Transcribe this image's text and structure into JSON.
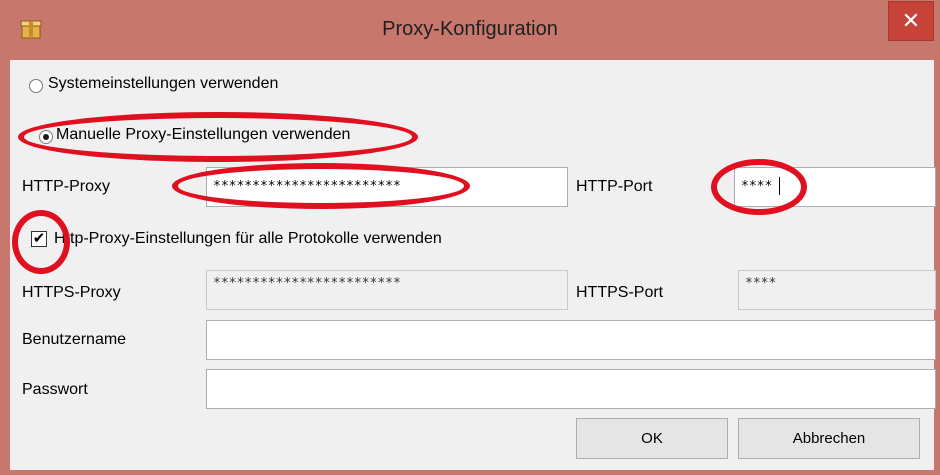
{
  "window": {
    "title": "Proxy-Konfiguration",
    "close_label": "✕",
    "app_icon": "box-icon"
  },
  "options": {
    "system_label": "Systemeinstellungen verwenden",
    "manual_label": "Manuelle Proxy-Einstellungen verwenden",
    "selected": "manual"
  },
  "http": {
    "proxy_label": "HTTP-Proxy",
    "proxy_value": "************************",
    "port_label": "HTTP-Port",
    "port_value": "****"
  },
  "use_for_all": {
    "label": "Http-Proxy-Einstellungen für alle Protokolle verwenden",
    "checked": true
  },
  "https": {
    "proxy_label": "HTTPS-Proxy",
    "proxy_value": "************************",
    "port_label": "HTTPS-Port",
    "port_value": "****"
  },
  "auth": {
    "username_label": "Benutzername",
    "username_value": "",
    "password_label": "Passwort",
    "password_value": ""
  },
  "buttons": {
    "ok_label": "OK",
    "cancel_label": "Abbrechen"
  },
  "colors": {
    "window_frame": "#c8776d",
    "close_button": "#c7433a",
    "annotation": "#e01020",
    "client_bg": "#f0f0f0"
  }
}
